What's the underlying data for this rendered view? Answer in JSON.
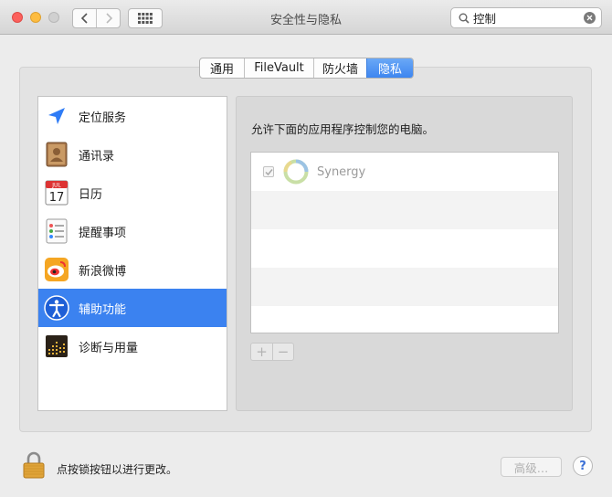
{
  "window": {
    "title": "安全性与隐私"
  },
  "search": {
    "value": "控制",
    "icon": "search-icon"
  },
  "tabs": [
    {
      "label": "通用",
      "active": false
    },
    {
      "label": "FileVault",
      "active": false
    },
    {
      "label": "防火墙",
      "active": false
    },
    {
      "label": "隐私",
      "active": true
    }
  ],
  "categories": [
    {
      "label": "定位服务",
      "icon": "location-icon",
      "selected": false
    },
    {
      "label": "通讯录",
      "icon": "contacts-icon",
      "selected": false
    },
    {
      "label": "日历",
      "icon": "calendar-icon",
      "selected": false,
      "icon_text_month": "JUL",
      "icon_text_day": "17"
    },
    {
      "label": "提醒事项",
      "icon": "reminders-icon",
      "selected": false
    },
    {
      "label": "新浪微博",
      "icon": "weibo-icon",
      "selected": false
    },
    {
      "label": "辅助功能",
      "icon": "accessibility-icon",
      "selected": true
    },
    {
      "label": "诊断与用量",
      "icon": "diagnostics-icon",
      "selected": false
    }
  ],
  "panel": {
    "description": "允许下面的应用程序控制您的电脑。",
    "apps": [
      {
        "name": "Synergy",
        "checked": true,
        "icon": "synergy-icon"
      }
    ],
    "add_label": "+",
    "remove_label": "−"
  },
  "footer": {
    "lock_text": "点按锁按钮以进行更改。",
    "advanced_label": "高级…",
    "help_label": "?"
  },
  "colors": {
    "accent": "#3b82f0",
    "close": "#fc605c",
    "minimize": "#fdbc40"
  }
}
